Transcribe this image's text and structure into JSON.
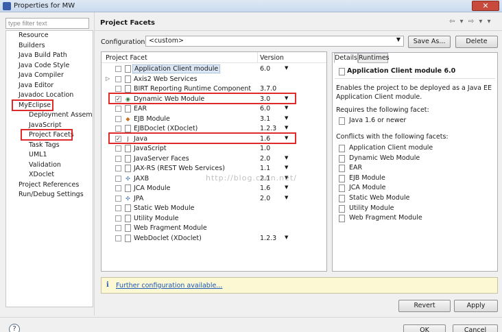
{
  "window": {
    "title": "Properties for MW",
    "close": "✕"
  },
  "filter": {
    "placeholder": "type filter text"
  },
  "nav": {
    "items": [
      {
        "label": "Resource",
        "indent": 0
      },
      {
        "label": "Builders",
        "indent": 0
      },
      {
        "label": "Java Build Path",
        "indent": 0
      },
      {
        "label": "Java Code Style",
        "indent": 0
      },
      {
        "label": "Java Compiler",
        "indent": 0
      },
      {
        "label": "Java Editor",
        "indent": 0
      },
      {
        "label": "Javadoc Location",
        "indent": 0
      },
      {
        "label": "MyEclipse",
        "indent": 0
      },
      {
        "label": "Deployment Assembl",
        "indent": 1
      },
      {
        "label": "JavaScript",
        "indent": 1
      },
      {
        "label": "Project Facets",
        "indent": 1
      },
      {
        "label": "Task Tags",
        "indent": 1
      },
      {
        "label": "UML1",
        "indent": 1
      },
      {
        "label": "Validation",
        "indent": 1
      },
      {
        "label": "XDoclet",
        "indent": 1
      },
      {
        "label": "Project References",
        "indent": 0
      },
      {
        "label": "Run/Debug Settings",
        "indent": 0
      }
    ]
  },
  "header": {
    "title": "Project Facets",
    "nav_arrows": "⇦ ▾ ⇨ ▾ ▾"
  },
  "configuration": {
    "label": "Configuration:",
    "value": "<custom>",
    "save_as": "Save As...",
    "delete": "Delete"
  },
  "facets": {
    "col_facet": "Project Facet",
    "col_version": "Version",
    "rows": [
      {
        "name": "Application Client module",
        "version": "6.0",
        "checked": false,
        "dropdown": true,
        "expander": false,
        "icon": "page-icon",
        "selected": true
      },
      {
        "name": "Axis2 Web Services",
        "version": "",
        "checked": false,
        "dropdown": false,
        "expander": true,
        "icon": "page-icon"
      },
      {
        "name": "BIRT Reporting Runtime Component",
        "version": "3.7.0",
        "checked": false,
        "dropdown": false,
        "expander": false,
        "icon": "page-icon"
      },
      {
        "name": "Dynamic Web Module",
        "version": "3.0",
        "checked": true,
        "dropdown": true,
        "expander": false,
        "icon": "web-module-icon"
      },
      {
        "name": "EAR",
        "version": "6.0",
        "checked": false,
        "dropdown": true,
        "expander": false,
        "icon": "page-icon"
      },
      {
        "name": "EJB Module",
        "version": "3.1",
        "checked": false,
        "dropdown": true,
        "expander": false,
        "icon": "ejb-icon"
      },
      {
        "name": "EJBDoclet (XDoclet)",
        "version": "1.2.3",
        "checked": false,
        "dropdown": true,
        "expander": false,
        "icon": "page-icon"
      },
      {
        "name": "Java",
        "version": "1.6",
        "checked": true,
        "dropdown": true,
        "expander": false,
        "icon": "java-icon"
      },
      {
        "name": "JavaScript",
        "version": "1.0",
        "checked": false,
        "dropdown": false,
        "expander": false,
        "icon": "page-icon"
      },
      {
        "name": "JavaServer Faces",
        "version": "2.0",
        "checked": false,
        "dropdown": true,
        "expander": false,
        "icon": "page-icon"
      },
      {
        "name": "JAX-RS (REST Web Services)",
        "version": "1.1",
        "checked": false,
        "dropdown": true,
        "expander": false,
        "icon": "page-icon"
      },
      {
        "name": "JAXB",
        "version": "2.1",
        "checked": false,
        "dropdown": true,
        "expander": false,
        "icon": "jaxb-icon"
      },
      {
        "name": "JCA Module",
        "version": "1.6",
        "checked": false,
        "dropdown": true,
        "expander": false,
        "icon": "page-icon"
      },
      {
        "name": "JPA",
        "version": "2.0",
        "checked": false,
        "dropdown": true,
        "expander": false,
        "icon": "jpa-icon"
      },
      {
        "name": "Static Web Module",
        "version": "",
        "checked": false,
        "dropdown": false,
        "expander": false,
        "icon": "page-icon"
      },
      {
        "name": "Utility Module",
        "version": "",
        "checked": false,
        "dropdown": false,
        "expander": false,
        "icon": "page-icon"
      },
      {
        "name": "Web Fragment Module",
        "version": "",
        "checked": false,
        "dropdown": false,
        "expander": false,
        "icon": "page-icon"
      },
      {
        "name": "WebDoclet (XDoclet)",
        "version": "1.2.3",
        "checked": false,
        "dropdown": true,
        "expander": false,
        "icon": "page-icon"
      }
    ]
  },
  "details": {
    "tab_details": "Details",
    "tab_runtimes": "Runtimes",
    "title": "Application Client module 6.0",
    "desc1": "Enables the project to be deployed as a Java EE",
    "desc2": "Application Client module.",
    "requires_label": "Requires the following facet:",
    "requires": [
      "Java 1.6 or newer"
    ],
    "conflicts_label": "Conflicts with the following facets:",
    "conflicts": [
      "Application Client module",
      "Dynamic Web Module",
      "EAR",
      "EJB Module",
      "JCA Module",
      "Static Web Module",
      "Utility Module",
      "Web Fragment Module"
    ]
  },
  "info": {
    "link": "Further configuration available..."
  },
  "buttons": {
    "revert": "Revert",
    "apply": "Apply",
    "ok": "OK",
    "cancel": "Cancel"
  },
  "watermark": "http://blog.csdn.net/",
  "highlight_color": "#e02a2a"
}
